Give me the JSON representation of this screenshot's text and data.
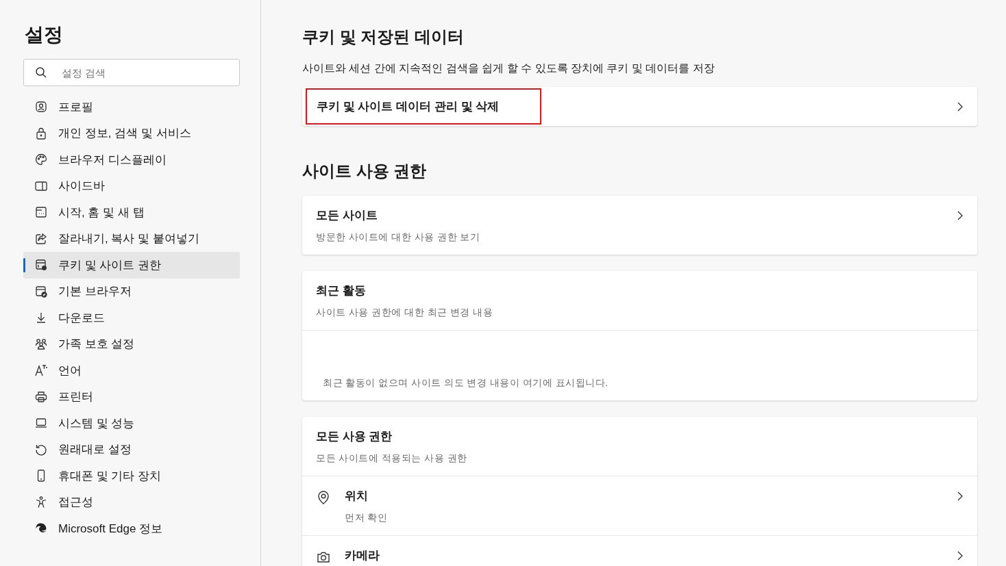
{
  "sidebar": {
    "title": "설정",
    "search": {
      "placeholder": "설정 검색"
    },
    "items": [
      {
        "label": "프로필",
        "selected": false
      },
      {
        "label": "개인 정보, 검색 및 서비스",
        "selected": false
      },
      {
        "label": "브라우저 디스플레이",
        "selected": false
      },
      {
        "label": "사이드바",
        "selected": false
      },
      {
        "label": "시작, 홈 및 새 탭",
        "selected": false
      },
      {
        "label": "잘라내기, 복사 및 붙여넣기",
        "selected": false
      },
      {
        "label": "쿠키 및 사이트 권한",
        "selected": true
      },
      {
        "label": "기본 브라우저",
        "selected": false
      },
      {
        "label": "다운로드",
        "selected": false
      },
      {
        "label": "가족 보호 설정",
        "selected": false
      },
      {
        "label": "언어",
        "selected": false
      },
      {
        "label": "프린터",
        "selected": false
      },
      {
        "label": "시스템 및 성능",
        "selected": false
      },
      {
        "label": "원래대로 설정",
        "selected": false
      },
      {
        "label": "휴대폰 및 기타 장치",
        "selected": false
      },
      {
        "label": "접근성",
        "selected": false
      },
      {
        "label": "Microsoft Edge 정보",
        "selected": false
      }
    ]
  },
  "sections": [
    {
      "heading": "쿠키 및 저장된 데이터",
      "description": "사이트와 세션 간에 지속적인 검색을 쉽게 할 수 있도록 장치에 쿠키 및 데이터를 저장",
      "cards": [
        {
          "rows": [
            {
              "kind": "link",
              "title": "쿠키 및 사이트 데이터 관리 및 삭제",
              "highlighted": true
            }
          ]
        }
      ]
    },
    {
      "heading": "사이트 사용 권한",
      "cards": [
        {
          "rows": [
            {
              "kind": "link",
              "title": "모든 사이트",
              "subtitle": "방문한 사이트에 대한 사용 권한 보기",
              "highlighted": false
            }
          ]
        },
        {
          "rows": [
            {
              "kind": "header",
              "title": "최근 활동",
              "subtitle": "사이트 사용 권한에 대한 최근 변경 내용"
            },
            {
              "kind": "empty",
              "text": "최근 활동이 없으며 사이트 의도 변경 내용이 여기에 표시됩니다."
            }
          ]
        },
        {
          "rows": [
            {
              "kind": "header",
              "title": "모든 사용 권한",
              "subtitle": "모든 사이트에 적용되는 사용 권한"
            },
            {
              "kind": "permission",
              "title": "위치",
              "subtitle": "먼저 확인"
            },
            {
              "kind": "permission",
              "title": "카메라"
            }
          ]
        }
      ]
    }
  ]
}
